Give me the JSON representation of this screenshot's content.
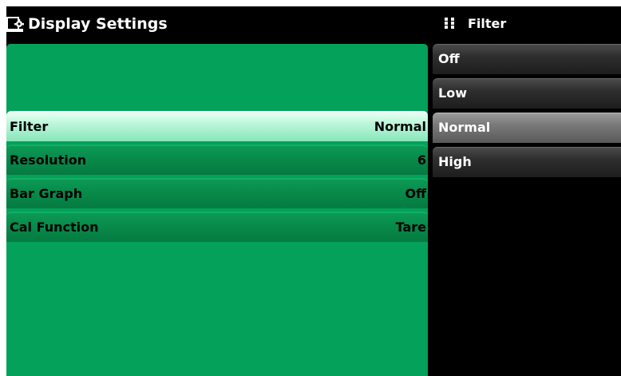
{
  "header": {
    "title": "Display Settings",
    "icon": "display-settings-icon"
  },
  "settings": [
    {
      "label": "Filter",
      "value": "Normal",
      "selected": true
    },
    {
      "label": "Resolution",
      "value": "6",
      "selected": false
    },
    {
      "label": "Bar Graph",
      "value": "Off",
      "selected": false
    },
    {
      "label": "Cal Function",
      "value": "Tare",
      "selected": false
    }
  ],
  "filter_menu": {
    "title": "Filter",
    "icon": "grip-icon",
    "options": [
      "Off",
      "Low",
      "Normal",
      "High"
    ],
    "selected": "Normal"
  },
  "colors": {
    "panel": "#03a15a",
    "selected_row": "#bff7dc",
    "menu_option": "#2e2e2e",
    "menu_selected": "#787878",
    "background": "#000000"
  }
}
